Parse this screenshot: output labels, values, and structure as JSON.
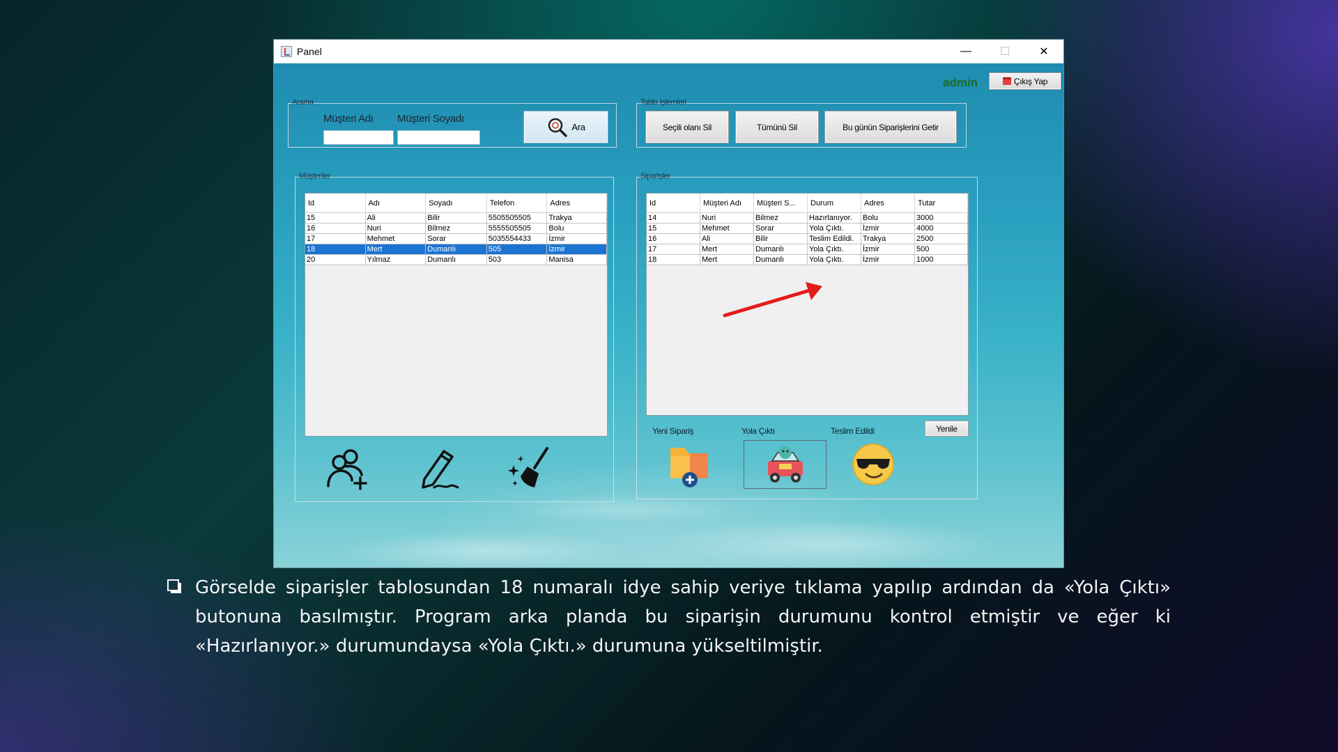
{
  "window": {
    "title": "Panel",
    "user_label": "admin",
    "logout_label": "Çıkış Yap"
  },
  "search": {
    "group_title": "Arama",
    "first_name_label": "Müşteri Adı",
    "last_name_label": "Müşteri Soyadı",
    "first_name_value": "",
    "last_name_value": "",
    "button_label": "Ara"
  },
  "table_ops": {
    "group_title": "Tablo İşlemleri",
    "delete_selected": "Seçili olanı Sil",
    "delete_all": "Tümünü Sil",
    "today_orders": "Bu günün Siparişlerini Getir"
  },
  "customers": {
    "group_title": "Müşteriler",
    "columns": [
      "Id",
      "Adı",
      "Soyadı",
      "Telefon",
      "Adres"
    ],
    "rows": [
      [
        "15",
        "Ali",
        "Bilir",
        "5505505505",
        "Trakya"
      ],
      [
        "16",
        "Nuri",
        "Bilmez",
        "5555505505",
        "Bolu"
      ],
      [
        "17",
        "Mehmet",
        "Sorar",
        "5035554433",
        "İzmir"
      ],
      [
        "18",
        "Mert",
        "Dumanlı",
        "505",
        "İzmir"
      ],
      [
        "20",
        "Yılmaz",
        "Dumanlı",
        "503",
        "Manisa"
      ]
    ],
    "selected_row": 3,
    "icons": [
      "add-user-icon",
      "edit-pen-icon",
      "clean-broom-icon"
    ]
  },
  "orders": {
    "group_title": "Siparişler",
    "columns": [
      "Id",
      "Müşteri Adı",
      "Müşteri S...",
      "Durum",
      "Adres",
      "Tutar"
    ],
    "rows": [
      [
        "14",
        "Nuri",
        "Bilmez",
        "Hazırlanıyor.",
        "Bolu",
        "3000"
      ],
      [
        "15",
        "Mehmet",
        "Sorar",
        "Yola Çıktı.",
        "İzmir",
        "4000"
      ],
      [
        "16",
        "Ali",
        "Bilir",
        "Teslim Edildi.",
        "Trakya",
        "2500"
      ],
      [
        "17",
        "Mert",
        "Dumanlı",
        "Yola Çıktı.",
        "İzmir",
        "500"
      ],
      [
        "18",
        "Mert",
        "Dumanlı",
        "Yola Çıktı.",
        "İzmir",
        "1000"
      ]
    ],
    "refresh_label": "Yenile",
    "new_order_label": "Yeni Sipariş",
    "shipped_label": "Yola Çıktı",
    "delivered_label": "Teslim Edildi"
  },
  "colors": {
    "selection": "#1b74d2",
    "arrow": "#e31b1b",
    "admin_text": "#1f6b2a"
  },
  "caption": "Görselde siparişler tablosundan 18 numaralı idye sahip veriye tıklama yapılıp ardından da «Yola Çıktı» butonuna basılmıştır. Program arka planda bu siparişin durumunu kontrol etmiştir ve eğer ki «Hazırlanıyor.» durumundaysa «Yola Çıktı.» durumuna yükseltilmiştir."
}
